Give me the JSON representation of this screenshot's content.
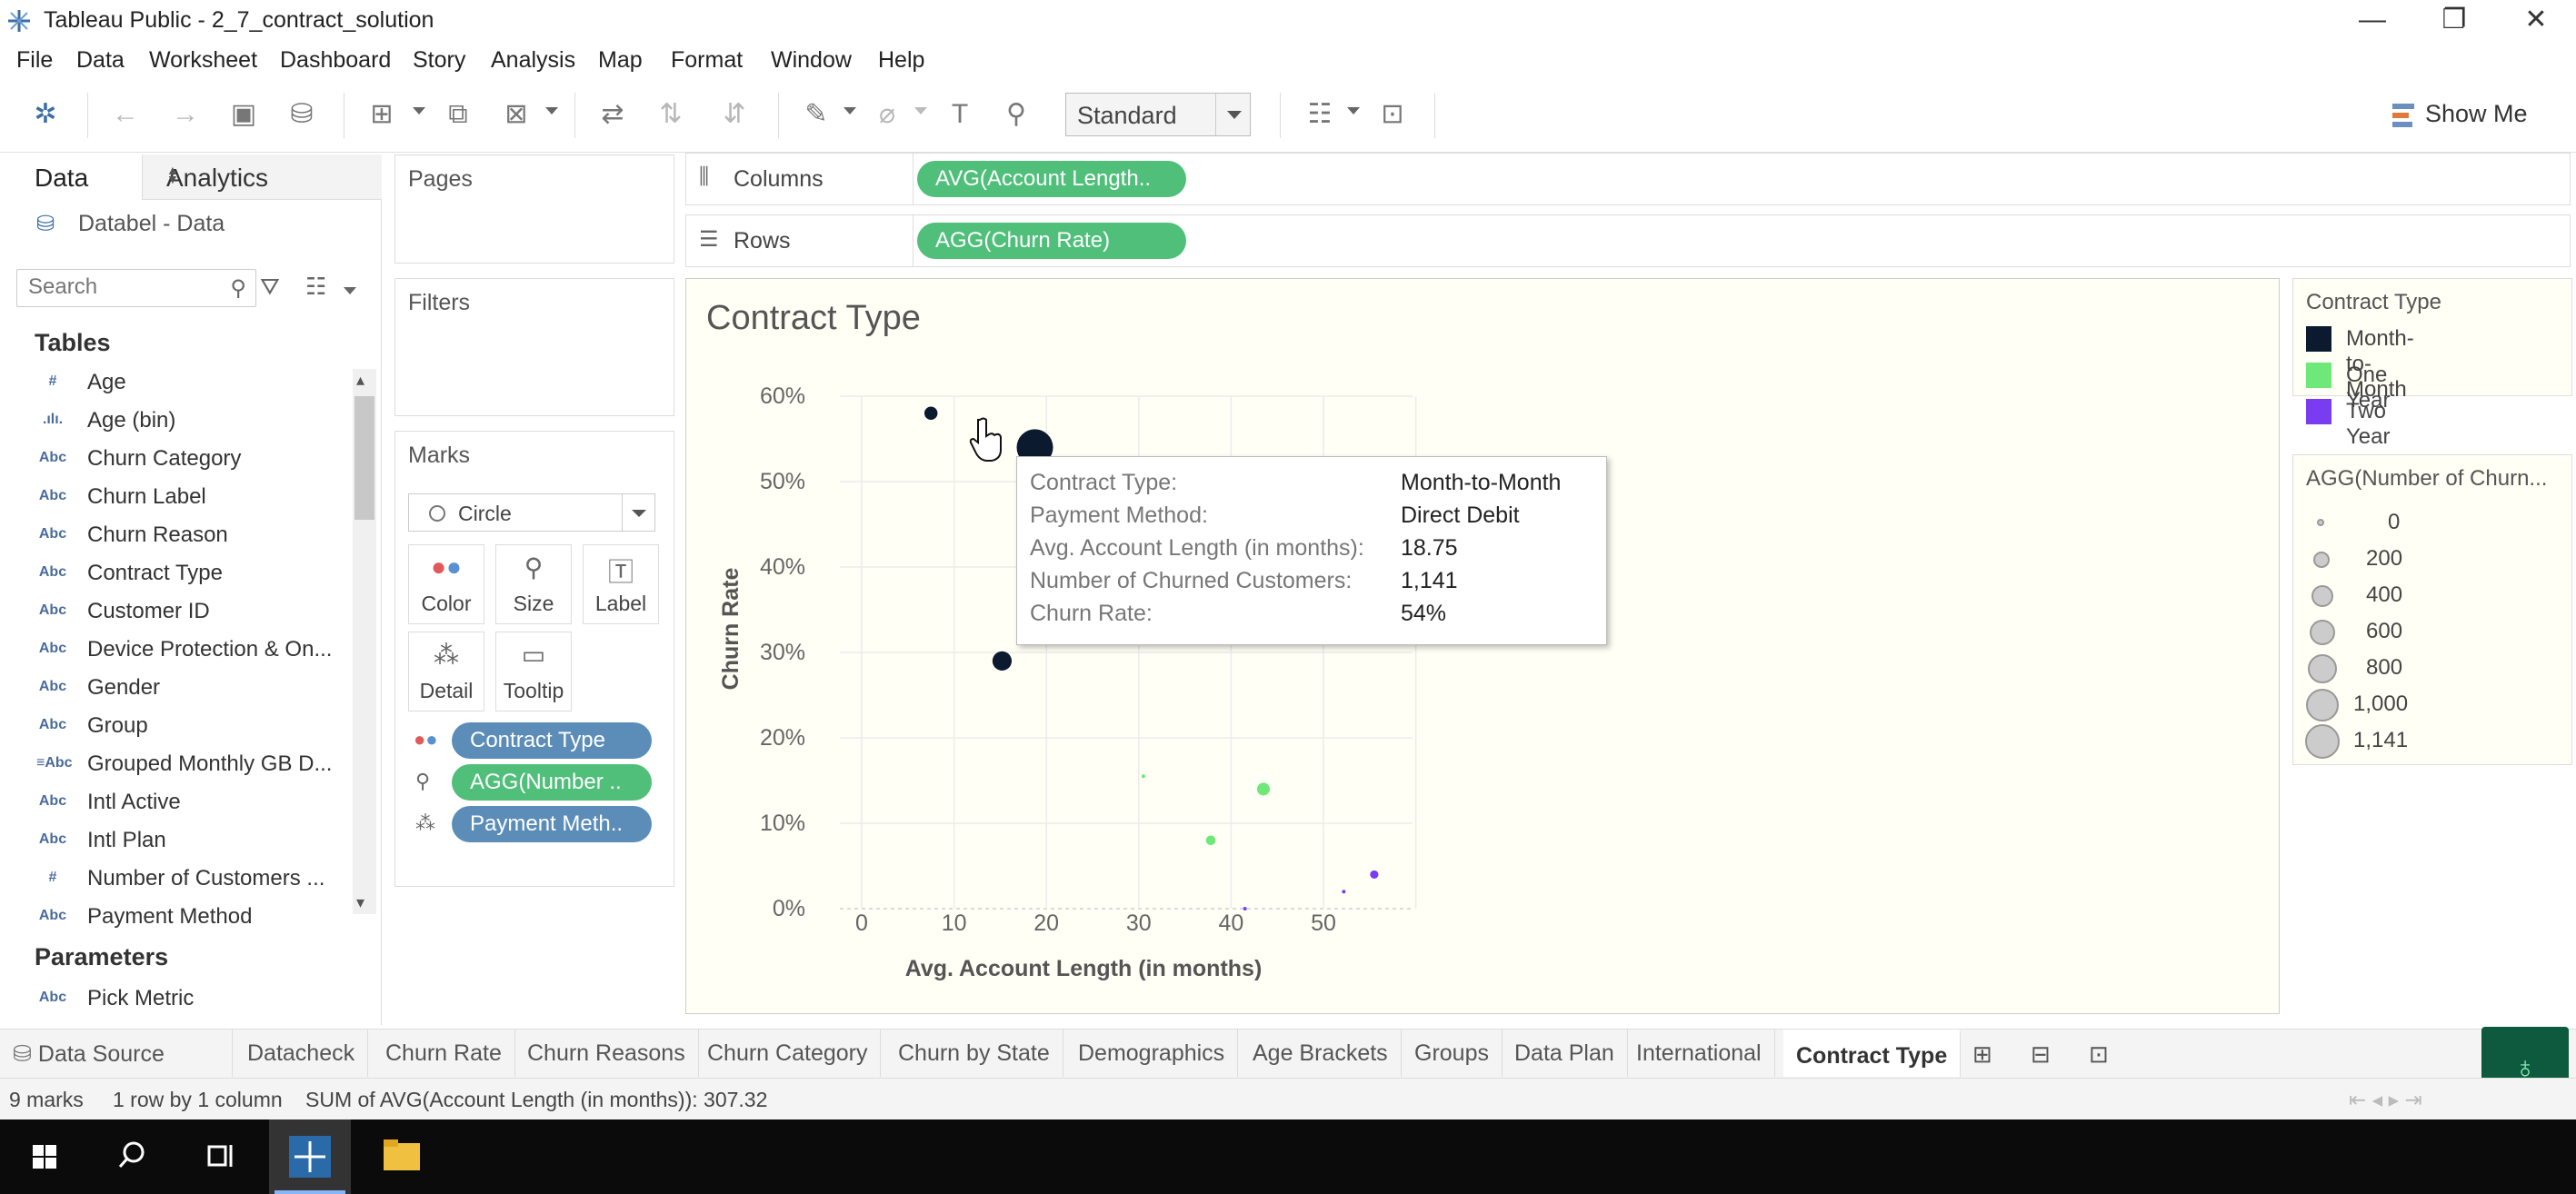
{
  "titlebar": {
    "title": "Tableau Public - 2_7_contract_solution",
    "minimize": "—",
    "restore": "❐",
    "close": "✕"
  },
  "menu": [
    "File",
    "Data",
    "Worksheet",
    "Dashboard",
    "Story",
    "Analysis",
    "Map",
    "Format",
    "Window",
    "Help"
  ],
  "toolbar": {
    "fit_dropdown": "Standard",
    "show_me": "Show Me"
  },
  "datapane": {
    "tab_data": "Data",
    "tab_analytics": "Analytics",
    "datasource": "Databel - Data",
    "search_placeholder": "Search",
    "tables_heading": "Tables",
    "fields": [
      {
        "type": "#",
        "name": "Age"
      },
      {
        "type": ".ılı.",
        "name": "Age (bin)"
      },
      {
        "type": "Abc",
        "name": "Churn Category"
      },
      {
        "type": "Abc",
        "name": "Churn Label"
      },
      {
        "type": "Abc",
        "name": "Churn Reason"
      },
      {
        "type": "Abc",
        "name": "Contract Type"
      },
      {
        "type": "Abc",
        "name": "Customer ID"
      },
      {
        "type": "Abc",
        "name": "Device Protection & On..."
      },
      {
        "type": "Abc",
        "name": "Gender"
      },
      {
        "type": "Abc",
        "name": "Group"
      },
      {
        "type": "≡Abc",
        "name": "Grouped Monthly GB D..."
      },
      {
        "type": "Abc",
        "name": "Intl Active"
      },
      {
        "type": "Abc",
        "name": "Intl Plan"
      },
      {
        "type": "#",
        "name": "Number of Customers ..."
      },
      {
        "type": "Abc",
        "name": "Payment Method"
      }
    ],
    "parameters_heading": "Parameters",
    "parameters": [
      {
        "type": "Abc",
        "name": "Pick Metric"
      }
    ]
  },
  "cards": {
    "pages": "Pages",
    "filters": "Filters",
    "marks": "Marks",
    "mark_type": "Circle"
  },
  "mark_buttons": {
    "color": "Color",
    "size": "Size",
    "label": "Label",
    "detail": "Detail",
    "tooltip": "Tooltip"
  },
  "mark_pills": [
    "Contract Type",
    "AGG(Number ..",
    "Payment Meth.."
  ],
  "shelves": {
    "columns_label": "Columns",
    "columns_pill": "AVG(Account Length..",
    "rows_label": "Rows",
    "rows_pill": "AGG(Churn Rate)"
  },
  "sheet_title": "Contract Type",
  "legend_color": {
    "title": "Contract Type",
    "items": [
      {
        "label": "Month-to-Month",
        "color": "#0b1a2e"
      },
      {
        "label": "One Year",
        "color": "#6ee878"
      },
      {
        "label": "Two Year",
        "color": "#7a3cf0"
      }
    ]
  },
  "legend_size": {
    "title": "AGG(Number of Churn...",
    "items": [
      "0",
      "200",
      "400",
      "600",
      "800",
      "1,000",
      "1,141"
    ]
  },
  "tooltip": {
    "rows": [
      {
        "k": "Contract Type:",
        "v": "Month-to-Month"
      },
      {
        "k": "Payment Method:",
        "v": "Direct Debit"
      },
      {
        "k": "Avg. Account Length (in months):",
        "v": "18.75"
      },
      {
        "k": "Number of Churned Customers:",
        "v": "1,141"
      },
      {
        "k": "Churn Rate:",
        "v": "54%"
      }
    ]
  },
  "chart_data": {
    "type": "scatter",
    "title": "Contract Type",
    "xlabel": "Avg. Account Length (in months)",
    "ylabel": "Churn Rate",
    "xlim": [
      0,
      60
    ],
    "ylim": [
      0,
      0.6
    ],
    "x_ticks": [
      "0",
      "10",
      "20",
      "30",
      "40",
      "50"
    ],
    "y_ticks": [
      "0%",
      "10%",
      "20%",
      "30%",
      "40%",
      "50%",
      "60%"
    ],
    "grid": true,
    "series": [
      {
        "name": "Month-to-Month",
        "color": "#0b1a2e",
        "points": [
          {
            "x": 7.5,
            "y": 0.58,
            "n": 150
          },
          {
            "x": 18.75,
            "y": 0.54,
            "n": 1141
          },
          {
            "x": 15.2,
            "y": 0.29,
            "n": 320
          }
        ]
      },
      {
        "name": "One Year",
        "color": "#6ee878",
        "points": [
          {
            "x": 30.5,
            "y": 0.155,
            "n": 10
          },
          {
            "x": 43.5,
            "y": 0.14,
            "n": 140
          },
          {
            "x": 37.8,
            "y": 0.08,
            "n": 80
          }
        ]
      },
      {
        "name": "Two Year",
        "color": "#7a3cf0",
        "points": [
          {
            "x": 55.5,
            "y": 0.04,
            "n": 60
          },
          {
            "x": 52.2,
            "y": 0.02,
            "n": 10
          },
          {
            "x": 41.5,
            "y": 0.0,
            "n": 5
          }
        ]
      }
    ]
  },
  "sheet_tabs": [
    "Datacheck",
    "Churn Rate",
    "Churn Reasons",
    "Churn Category",
    "Churn by State",
    "Demographics",
    "Age Brackets",
    "Groups",
    "Data Plan",
    "International",
    "Contract Type"
  ],
  "data_source_tab": "Data Source",
  "active_tab": "Contract Type",
  "status": {
    "marks": "9 marks",
    "dims": "1 row by 1 column",
    "sum": "SUM of AVG(Account Length (in months)): 307.32"
  }
}
